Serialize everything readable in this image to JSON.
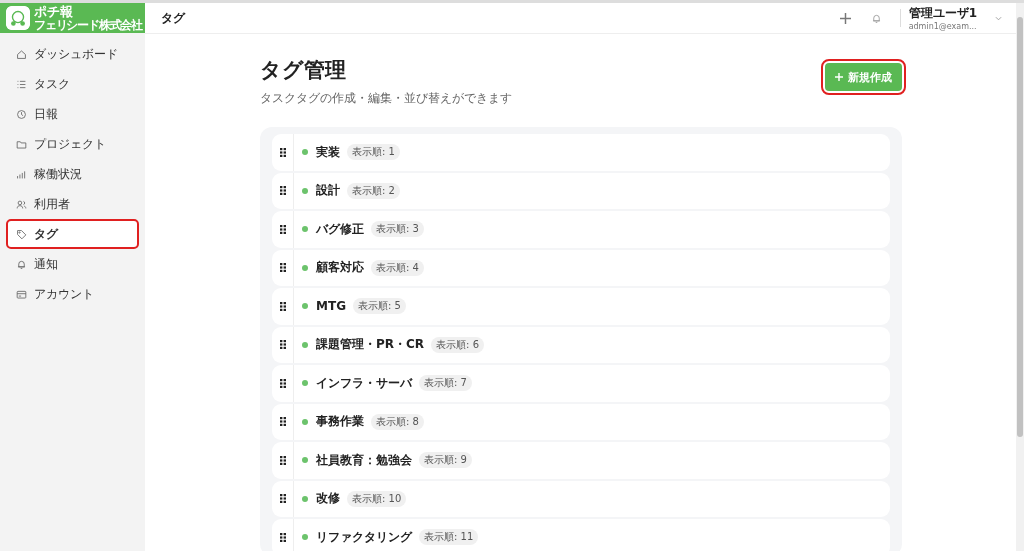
{
  "app": {
    "name": "ポチ報",
    "company": "フェリシード株式会社"
  },
  "header": {
    "breadcrumb": "タグ",
    "user": {
      "name": "管理ユーザ1",
      "email": "admin1@exam..."
    }
  },
  "sidebar": {
    "items": [
      {
        "label": "ダッシュボード",
        "kind": "home",
        "selected": false,
        "highlighted": false
      },
      {
        "label": "タスク",
        "kind": "list",
        "selected": false,
        "highlighted": false
      },
      {
        "label": "日報",
        "kind": "clock",
        "selected": false,
        "highlighted": false
      },
      {
        "label": "プロジェクト",
        "kind": "folder",
        "selected": false,
        "highlighted": false
      },
      {
        "label": "稼働状況",
        "kind": "chart",
        "selected": false,
        "highlighted": false
      },
      {
        "label": "利用者",
        "kind": "users",
        "selected": false,
        "highlighted": false
      },
      {
        "label": "タグ",
        "kind": "tag",
        "selected": true,
        "highlighted": true
      },
      {
        "label": "通知",
        "kind": "bell",
        "selected": false,
        "highlighted": false
      },
      {
        "label": "アカウント",
        "kind": "card",
        "selected": false,
        "highlighted": false
      }
    ]
  },
  "page": {
    "title": "タグ管理",
    "subtitle": "タスクタグの作成・編集・並び替えができます",
    "new_button": {
      "label": "新規作成",
      "highlighted": true
    }
  },
  "tags": [
    {
      "name": "実装",
      "order": "表示順: 1",
      "color": "#6cc36c"
    },
    {
      "name": "設計",
      "order": "表示順: 2",
      "color": "#6cc36c"
    },
    {
      "name": "バグ修正",
      "order": "表示順: 3",
      "color": "#6cc36c"
    },
    {
      "name": "顧客対応",
      "order": "表示順: 4",
      "color": "#6cc36c"
    },
    {
      "name": "MTG",
      "order": "表示順: 5",
      "color": "#6cc36c"
    },
    {
      "name": "課題管理・PR・CR",
      "order": "表示順: 6",
      "color": "#6cc36c"
    },
    {
      "name": "インフラ・サーバ",
      "order": "表示順: 7",
      "color": "#6cc36c"
    },
    {
      "name": "事務作業",
      "order": "表示順: 8",
      "color": "#6cc36c"
    },
    {
      "name": "社員教育：勉強会",
      "order": "表示順: 9",
      "color": "#6cc36c"
    },
    {
      "name": "改修",
      "order": "表示順: 10",
      "color": "#6cc36c"
    },
    {
      "name": "リファクタリング",
      "order": "表示順: 11",
      "color": "#6cc36c"
    }
  ]
}
